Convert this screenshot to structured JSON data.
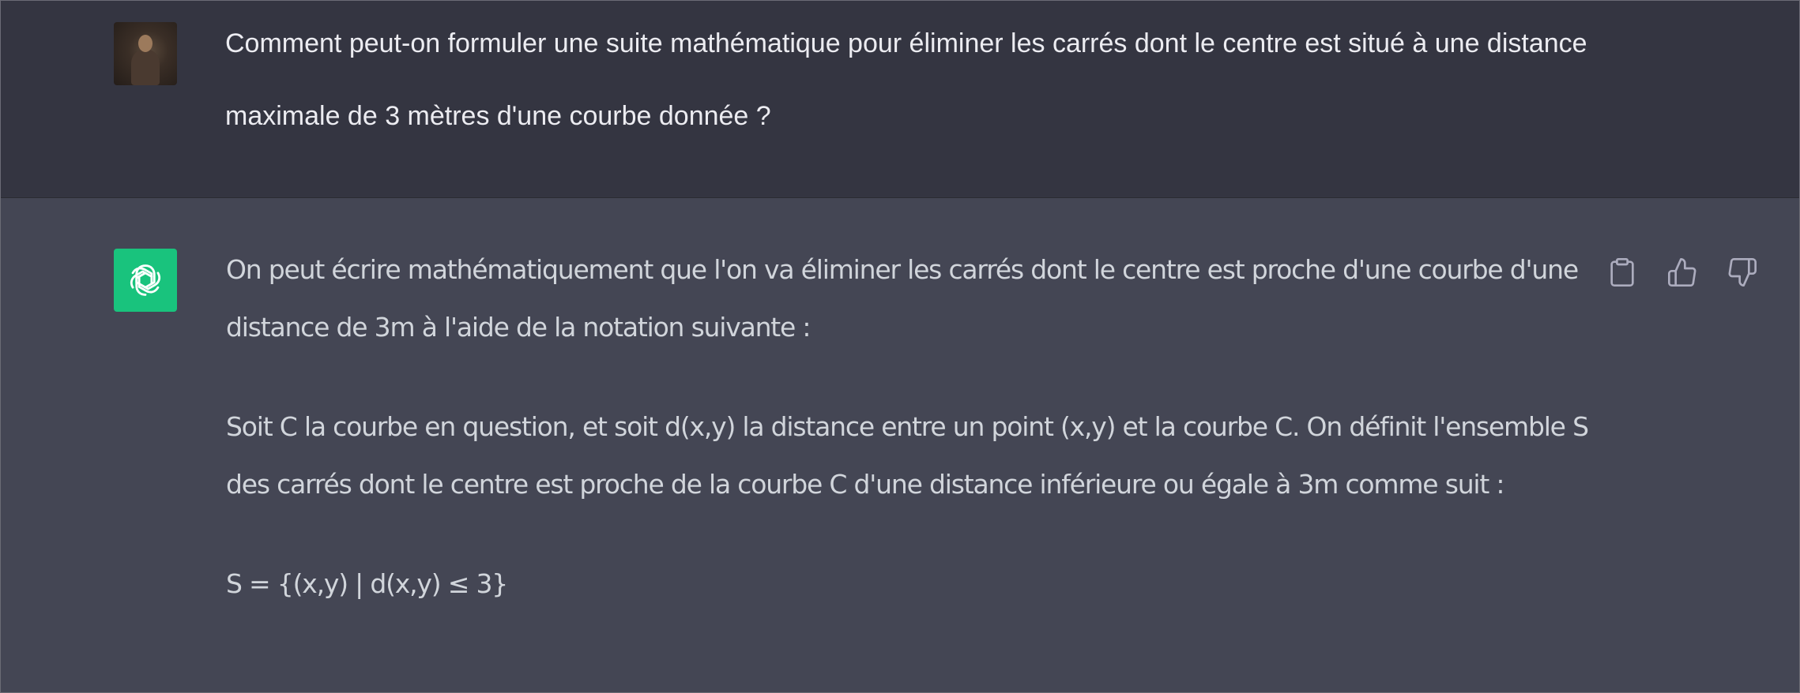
{
  "conversation": {
    "user_message": {
      "avatar": "user-photo-avatar",
      "text": "Comment peut-on formuler une suite mathématique pour éliminer les carrés dont le centre est situé à une distance maximale de 3 mètres d'une courbe donnée ?"
    },
    "assistant_message": {
      "avatar": "openai-logo-icon",
      "paragraphs": [
        "On peut écrire mathématiquement que l'on va éliminer les carrés dont le centre est proche d'une courbe d'une distance de 3m à l'aide de la notation suivante :",
        "Soit C la courbe en question, et soit d(x,y) la distance entre un point (x,y) et la courbe C. On définit l'ensemble S des carrés dont le centre est proche de la courbe C d'une distance inférieure ou égale à 3m comme suit :",
        "S = {(x,y) | d(x,y) ≤ 3}"
      ],
      "actions": [
        {
          "icon": "clipboard-icon"
        },
        {
          "icon": "thumbs-up-icon"
        },
        {
          "icon": "thumbs-down-icon"
        }
      ]
    }
  },
  "colors": {
    "user_bg": "#343541",
    "assistant_bg": "#444654",
    "bot_avatar": "#19c37d",
    "user_text": "#ececf1",
    "assistant_text": "#d1d5db",
    "icon": "#acacbe"
  }
}
